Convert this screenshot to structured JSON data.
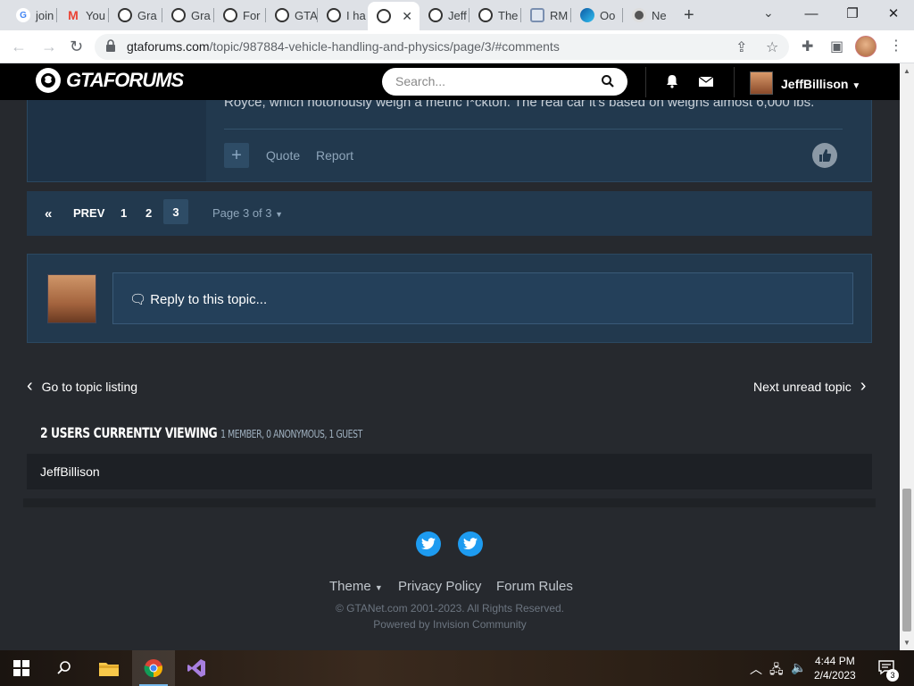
{
  "browser": {
    "tabs": [
      {
        "label": "join",
        "icon": "google-icon"
      },
      {
        "label": "You",
        "icon": "gmail-icon"
      },
      {
        "label": "Gra",
        "icon": "gtaforums-icon"
      },
      {
        "label": "Gra",
        "icon": "gtaforums-icon"
      },
      {
        "label": "For",
        "icon": "gtaforums-icon"
      },
      {
        "label": "GTA",
        "icon": "gtaforums-icon"
      },
      {
        "label": "I ha",
        "icon": "gtaforums-icon"
      },
      {
        "label": "",
        "icon": "gtaforums-icon",
        "active": true
      },
      {
        "label": "Jeff",
        "icon": "gtaforums-icon"
      },
      {
        "label": "The",
        "icon": "gtaforums-icon"
      },
      {
        "label": "RM",
        "icon": "rm-icon"
      },
      {
        "label": "Oo",
        "icon": "edge-icon"
      },
      {
        "label": "Ne",
        "icon": "github-icon"
      }
    ],
    "url_host": "gtaforums.com",
    "url_path": "/topic/987884-vehicle-handling-and-physics/page/3/#comments"
  },
  "header": {
    "logo_text": "GTAFORUMS",
    "search_placeholder": "Search...",
    "username": "JeffBillison"
  },
  "post": {
    "text": "Royce, which notoriously weigh a metric f*ckton. The real car it's based on weighs almost 6,000 lbs.",
    "quote_label": "Quote",
    "report_label": "Report"
  },
  "pagination": {
    "prev_label": "PREV",
    "pages": [
      "1",
      "2",
      "3"
    ],
    "current": "3",
    "page_count_label": "Page 3 of 3"
  },
  "reply": {
    "placeholder": "Reply to this topic..."
  },
  "topic_nav": {
    "prev_label": "Go to topic listing",
    "next_label": "Next unread topic"
  },
  "viewing": {
    "title": "2 USERS CURRENTLY VIEWING",
    "summary": "1 MEMBER, 0 ANONYMOUS, 1 GUEST",
    "users": [
      "JeffBillison"
    ]
  },
  "footer": {
    "theme_label": "Theme",
    "privacy_label": "Privacy Policy",
    "rules_label": "Forum Rules",
    "copyright": "© GTANet.com 2001-2023. All Rights Reserved.",
    "powered": "Powered by Invision Community"
  },
  "taskbar": {
    "time": "4:44 PM",
    "date": "2/4/2023",
    "notification_count": "3"
  },
  "colors": {
    "accent": "#22394e",
    "page_bg": "#26292e",
    "header_bg": "#000000",
    "twitter": "#1d9bf0"
  }
}
